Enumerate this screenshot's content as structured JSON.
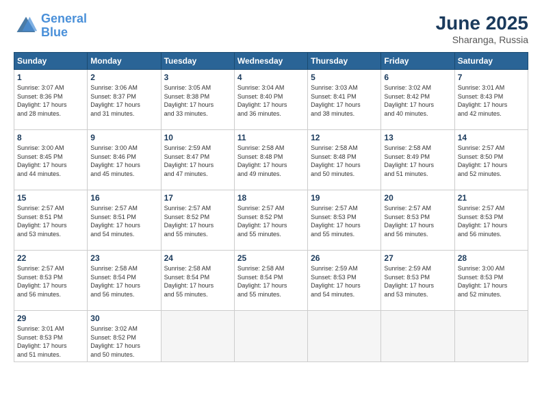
{
  "logo": {
    "line1": "General",
    "line2": "Blue"
  },
  "title": "June 2025",
  "location": "Sharanga, Russia",
  "headers": [
    "Sunday",
    "Monday",
    "Tuesday",
    "Wednesday",
    "Thursday",
    "Friday",
    "Saturday"
  ],
  "weeks": [
    [
      {
        "day": "1",
        "text": "Sunrise: 3:07 AM\nSunset: 8:36 PM\nDaylight: 17 hours\nand 28 minutes."
      },
      {
        "day": "2",
        "text": "Sunrise: 3:06 AM\nSunset: 8:37 PM\nDaylight: 17 hours\nand 31 minutes."
      },
      {
        "day": "3",
        "text": "Sunrise: 3:05 AM\nSunset: 8:38 PM\nDaylight: 17 hours\nand 33 minutes."
      },
      {
        "day": "4",
        "text": "Sunrise: 3:04 AM\nSunset: 8:40 PM\nDaylight: 17 hours\nand 36 minutes."
      },
      {
        "day": "5",
        "text": "Sunrise: 3:03 AM\nSunset: 8:41 PM\nDaylight: 17 hours\nand 38 minutes."
      },
      {
        "day": "6",
        "text": "Sunrise: 3:02 AM\nSunset: 8:42 PM\nDaylight: 17 hours\nand 40 minutes."
      },
      {
        "day": "7",
        "text": "Sunrise: 3:01 AM\nSunset: 8:43 PM\nDaylight: 17 hours\nand 42 minutes."
      }
    ],
    [
      {
        "day": "8",
        "text": "Sunrise: 3:00 AM\nSunset: 8:45 PM\nDaylight: 17 hours\nand 44 minutes."
      },
      {
        "day": "9",
        "text": "Sunrise: 3:00 AM\nSunset: 8:46 PM\nDaylight: 17 hours\nand 45 minutes."
      },
      {
        "day": "10",
        "text": "Sunrise: 2:59 AM\nSunset: 8:47 PM\nDaylight: 17 hours\nand 47 minutes."
      },
      {
        "day": "11",
        "text": "Sunrise: 2:58 AM\nSunset: 8:48 PM\nDaylight: 17 hours\nand 49 minutes."
      },
      {
        "day": "12",
        "text": "Sunrise: 2:58 AM\nSunset: 8:48 PM\nDaylight: 17 hours\nand 50 minutes."
      },
      {
        "day": "13",
        "text": "Sunrise: 2:58 AM\nSunset: 8:49 PM\nDaylight: 17 hours\nand 51 minutes."
      },
      {
        "day": "14",
        "text": "Sunrise: 2:57 AM\nSunset: 8:50 PM\nDaylight: 17 hours\nand 52 minutes."
      }
    ],
    [
      {
        "day": "15",
        "text": "Sunrise: 2:57 AM\nSunset: 8:51 PM\nDaylight: 17 hours\nand 53 minutes."
      },
      {
        "day": "16",
        "text": "Sunrise: 2:57 AM\nSunset: 8:51 PM\nDaylight: 17 hours\nand 54 minutes."
      },
      {
        "day": "17",
        "text": "Sunrise: 2:57 AM\nSunset: 8:52 PM\nDaylight: 17 hours\nand 55 minutes."
      },
      {
        "day": "18",
        "text": "Sunrise: 2:57 AM\nSunset: 8:52 PM\nDaylight: 17 hours\nand 55 minutes."
      },
      {
        "day": "19",
        "text": "Sunrise: 2:57 AM\nSunset: 8:53 PM\nDaylight: 17 hours\nand 55 minutes."
      },
      {
        "day": "20",
        "text": "Sunrise: 2:57 AM\nSunset: 8:53 PM\nDaylight: 17 hours\nand 56 minutes."
      },
      {
        "day": "21",
        "text": "Sunrise: 2:57 AM\nSunset: 8:53 PM\nDaylight: 17 hours\nand 56 minutes."
      }
    ],
    [
      {
        "day": "22",
        "text": "Sunrise: 2:57 AM\nSunset: 8:53 PM\nDaylight: 17 hours\nand 56 minutes."
      },
      {
        "day": "23",
        "text": "Sunrise: 2:58 AM\nSunset: 8:54 PM\nDaylight: 17 hours\nand 56 minutes."
      },
      {
        "day": "24",
        "text": "Sunrise: 2:58 AM\nSunset: 8:54 PM\nDaylight: 17 hours\nand 55 minutes."
      },
      {
        "day": "25",
        "text": "Sunrise: 2:58 AM\nSunset: 8:54 PM\nDaylight: 17 hours\nand 55 minutes."
      },
      {
        "day": "26",
        "text": "Sunrise: 2:59 AM\nSunset: 8:53 PM\nDaylight: 17 hours\nand 54 minutes."
      },
      {
        "day": "27",
        "text": "Sunrise: 2:59 AM\nSunset: 8:53 PM\nDaylight: 17 hours\nand 53 minutes."
      },
      {
        "day": "28",
        "text": "Sunrise: 3:00 AM\nSunset: 8:53 PM\nDaylight: 17 hours\nand 52 minutes."
      }
    ],
    [
      {
        "day": "29",
        "text": "Sunrise: 3:01 AM\nSunset: 8:53 PM\nDaylight: 17 hours\nand 51 minutes."
      },
      {
        "day": "30",
        "text": "Sunrise: 3:02 AM\nSunset: 8:52 PM\nDaylight: 17 hours\nand 50 minutes."
      },
      {
        "day": "",
        "text": ""
      },
      {
        "day": "",
        "text": ""
      },
      {
        "day": "",
        "text": ""
      },
      {
        "day": "",
        "text": ""
      },
      {
        "day": "",
        "text": ""
      }
    ]
  ]
}
